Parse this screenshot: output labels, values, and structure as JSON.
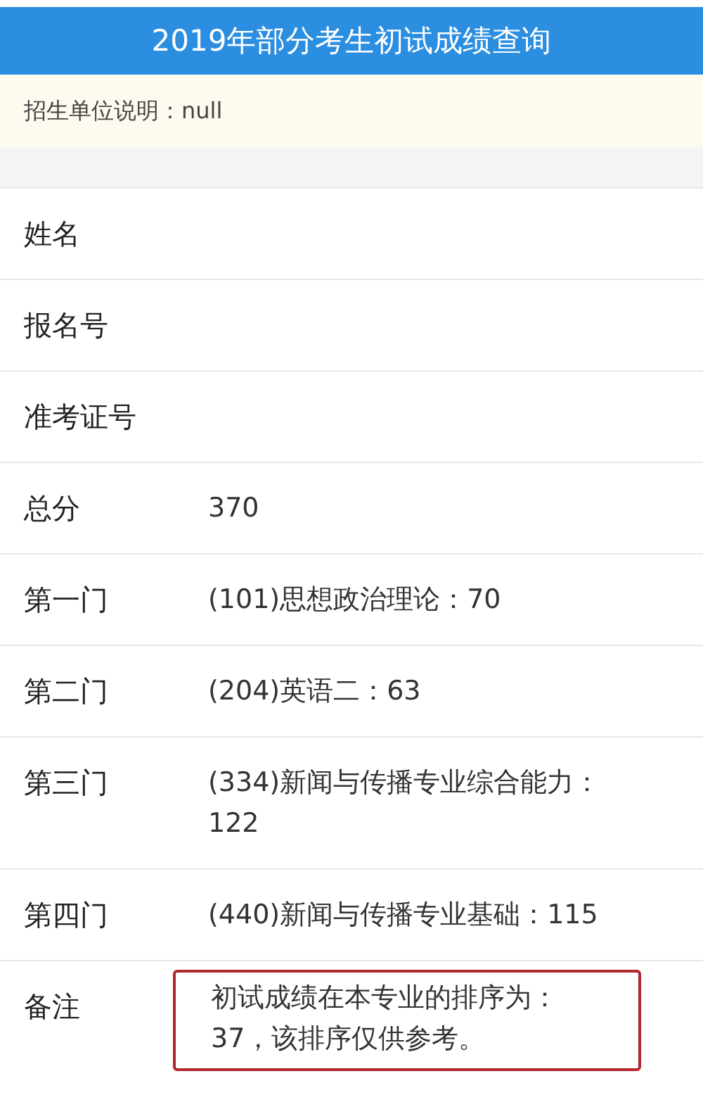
{
  "header": {
    "title": "2019年部分考生初试成绩查询"
  },
  "notice": {
    "text": "招生单位说明：null"
  },
  "rows": [
    {
      "label": "姓名"
    },
    {
      "label": "报名号"
    },
    {
      "label": "准考证号"
    },
    {
      "label": "总分",
      "value": "370"
    },
    {
      "label": "第一门",
      "value": "(101)思想政治理论：70"
    },
    {
      "label": "第二门",
      "value": "(204)英语二：63"
    },
    {
      "label": "第三门",
      "value": "(334)新闻与传播专业综合能力：122"
    },
    {
      "label": "第四门",
      "value": "(440)新闻与传播专业基础：115"
    }
  ],
  "remark": {
    "label": "备注",
    "text": "初试成绩在本专业的排序为：37，该排序仅供参考。"
  }
}
